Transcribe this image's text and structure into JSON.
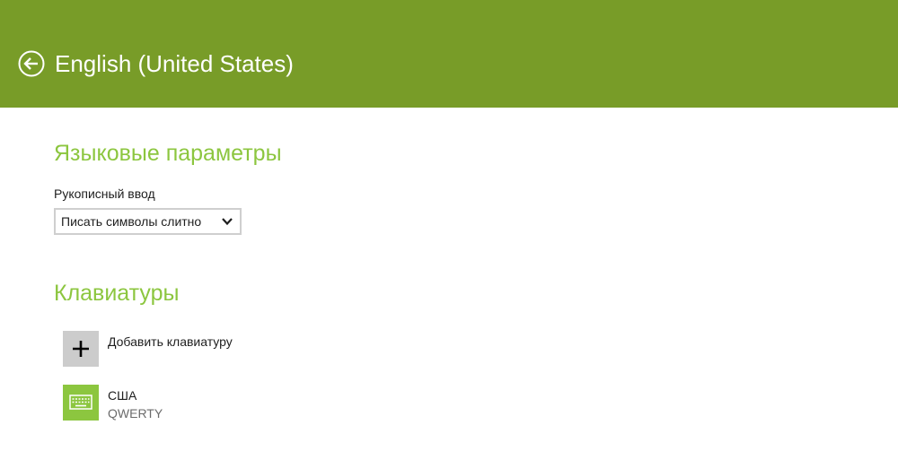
{
  "header": {
    "title": "English (United States)",
    "back_icon": "back-arrow-icon",
    "background_color": "#789c28"
  },
  "language_options": {
    "section_title": "Языковые параметры",
    "handwriting_label": "Рукописный ввод",
    "handwriting_selected": "Писать символы слитно",
    "accent_color": "#8cc63f"
  },
  "keyboards": {
    "section_title": "Клавиатуры",
    "add_label": "Добавить клавиатуру",
    "add_icon": "plus-icon",
    "items": [
      {
        "name": "США",
        "layout": "QWERTY",
        "icon": "keyboard-icon"
      }
    ]
  }
}
